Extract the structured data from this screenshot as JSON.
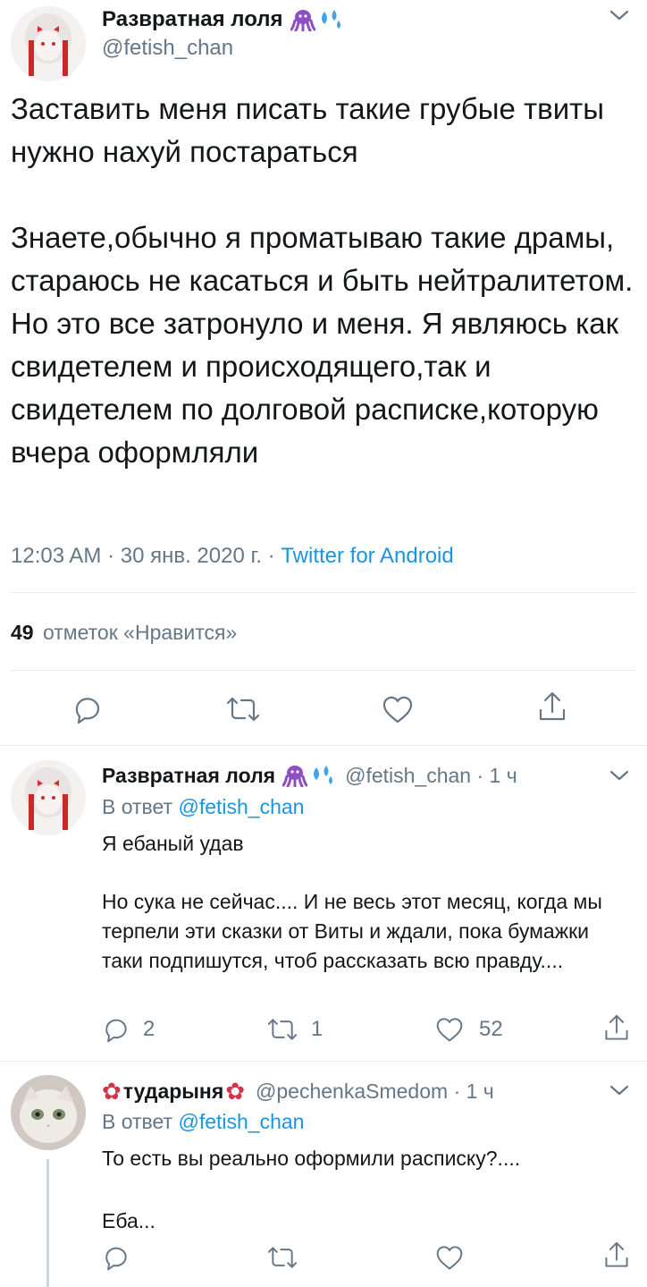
{
  "main_tweet": {
    "name": "Развратная лоля",
    "name_emojis": "🐙💦",
    "handle": "@fetish_chan",
    "text": "Заставить меня писать такие грубые твиты нужно нахуй постараться\n\nЗнаете,обычно я проматываю такие драмы, стараюсь не касаться и быть нейтралитетом. Но это все затронуло и меня. Я являюсь как свидетелем и происходящего,так и свидетелем по долговой расписке,которую вчера оформляли",
    "timestamp": "12:03 AM · 30 янв. 2020 г. · ",
    "source": "Twitter for Android",
    "likes_count": "49",
    "likes_label": "отметок «Нравится»"
  },
  "reply1": {
    "name": "Развратная лоля",
    "name_emojis": "🐙💦",
    "handle_time": "@fetish_chan · 1 ч",
    "reply_to_prefix": "В ответ ",
    "reply_to_handle": "@fetish_chan",
    "text": "Я ебаный удав\n\nНо сука не сейчас.... И не весь этот месяц, когда мы терпели эти сказки от Виты и ждали, пока бумажки таки подпишутся, чтоб рассказать всю правду....",
    "replies": "2",
    "retweets": "1",
    "likes": "52"
  },
  "reply2": {
    "name_prefix_emoji": "✿",
    "name": "тударыня",
    "name_suffix_emoji": "✿",
    "handle_time": "@pechenkaSmedom · 1 ч",
    "reply_to_prefix": "В ответ ",
    "reply_to_handle": "@fetish_chan",
    "text": "То есть вы реально оформили расписку?....\n\nЕба..."
  },
  "icons": [
    "chevron-down-icon",
    "reply-icon",
    "retweet-icon",
    "like-icon",
    "share-icon"
  ],
  "colors": {
    "link": "#1b95e0",
    "muted": "#657786",
    "divider": "#e6ecf0",
    "emoji_purple": "#8e4fc3",
    "emoji_blue": "#3ea6e8",
    "flower_red": "#d6334a"
  }
}
